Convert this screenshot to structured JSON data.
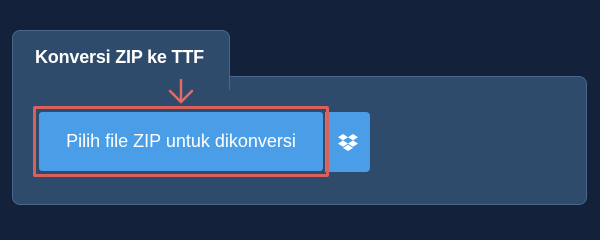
{
  "tab": {
    "title": "Konversi ZIP ke TTF"
  },
  "upload": {
    "button_label": "Pilih file ZIP untuk dikonversi"
  },
  "dropbox": {
    "icon": "dropbox-icon"
  },
  "colors": {
    "background": "#13213a",
    "panel": "#2e4b6c",
    "button": "#4a9ee8",
    "highlight": "#d9605c"
  }
}
